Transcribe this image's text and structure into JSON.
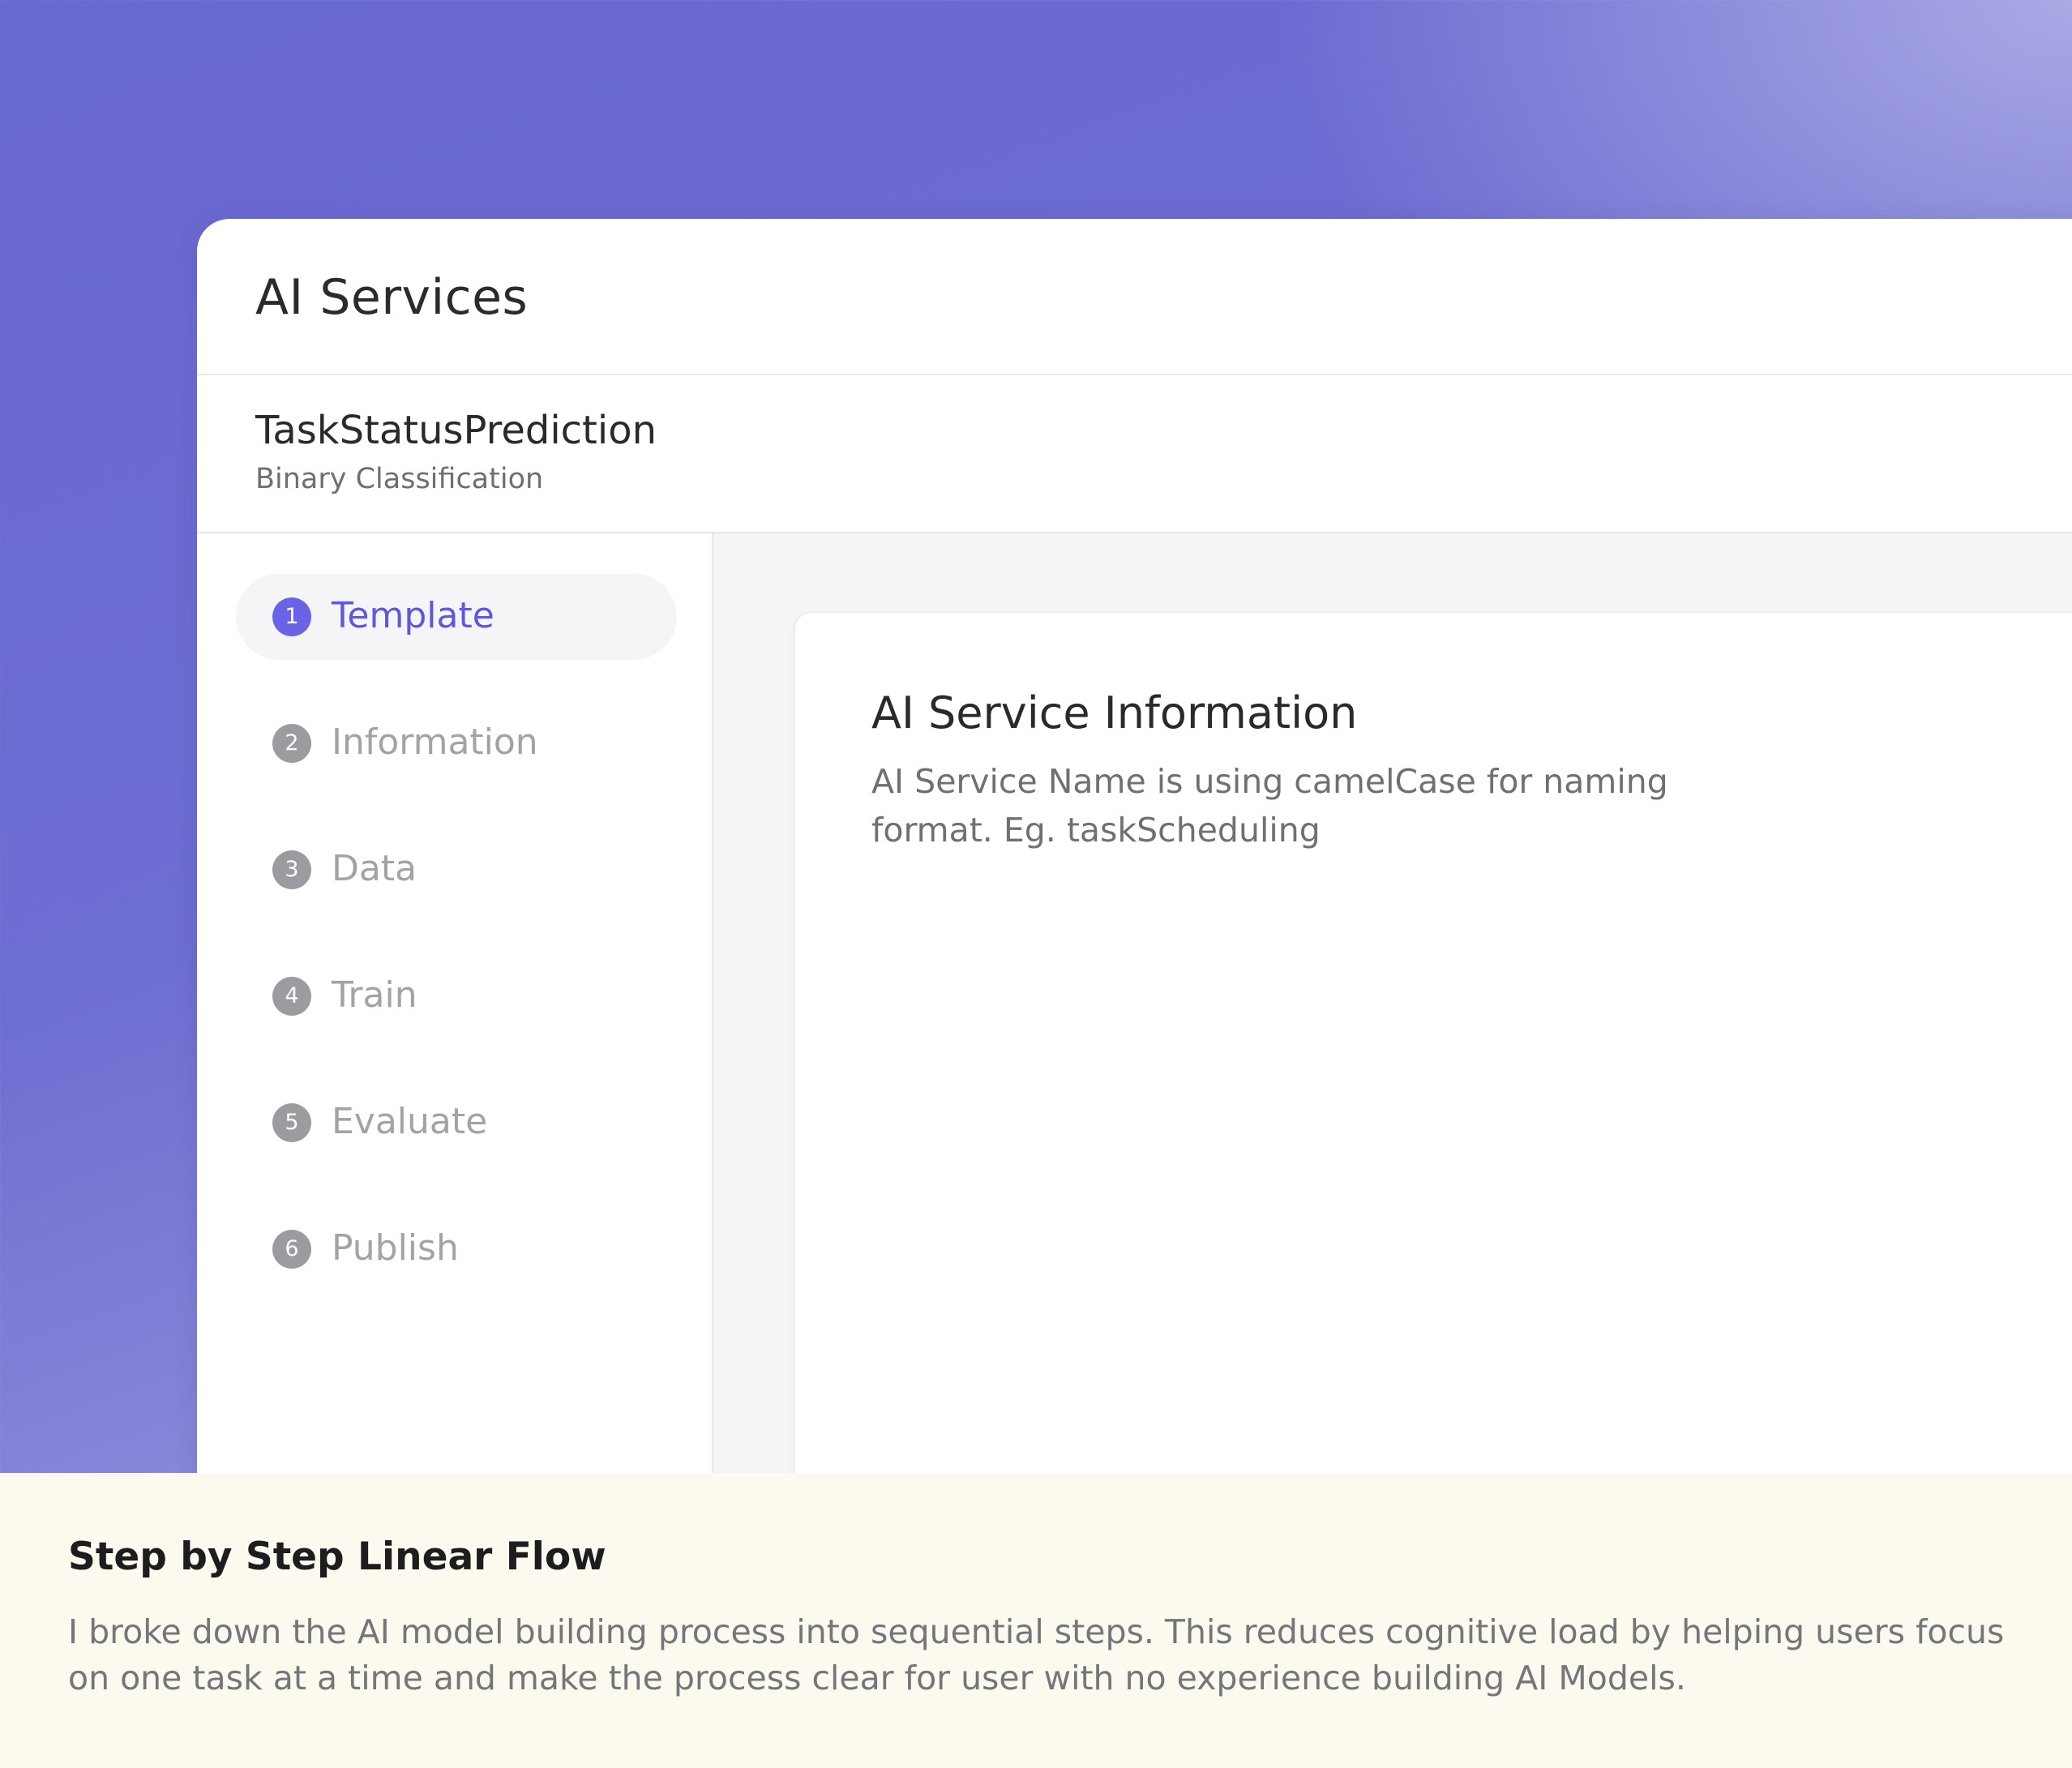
{
  "app": {
    "title": "AI Services"
  },
  "model": {
    "name": "TaskStatusPrediction",
    "type": "Binary Classification"
  },
  "steps": [
    {
      "number": "1",
      "label": "Template",
      "active": true
    },
    {
      "number": "2",
      "label": "Information",
      "active": false
    },
    {
      "number": "3",
      "label": "Data",
      "active": false
    },
    {
      "number": "4",
      "label": "Train",
      "active": false
    },
    {
      "number": "5",
      "label": "Evaluate",
      "active": false
    },
    {
      "number": "6",
      "label": "Publish",
      "active": false
    }
  ],
  "card": {
    "title": "AI Service Information",
    "description": "AI Service Name is using camelCase for naming format. Eg. taskScheduling"
  },
  "caption": {
    "title": "Step by Step Linear Flow",
    "text": "I broke down the AI model building process into sequential steps. This reduces cognitive load by helping users focus on one task at a time and make the process clear for user with no experience building AI Models."
  },
  "colors": {
    "accent": "#6a63e6",
    "background_gradient_start": "#6a68d1",
    "background_gradient_end": "#a7a6e0",
    "caption_background": "#fcf9ee"
  }
}
